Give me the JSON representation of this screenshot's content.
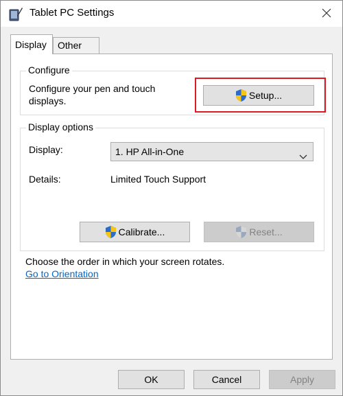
{
  "window": {
    "title": "Tablet PC Settings",
    "icons": {
      "app": "tablet-pen-icon",
      "close": "close-icon"
    }
  },
  "tabs": [
    {
      "label": "Display",
      "active": true
    },
    {
      "label": "Other",
      "active": false
    }
  ],
  "configure": {
    "legend": "Configure",
    "description_line1": "Configure your pen and touch",
    "description_line2": "displays.",
    "setup_label": "Setup..."
  },
  "display_options": {
    "legend": "Display options",
    "display_label": "Display:",
    "display_value": "1. HP All-in-One",
    "details_label": "Details:",
    "details_value": "Limited Touch Support",
    "calibrate_label": "Calibrate...",
    "reset_label": "Reset..."
  },
  "orientation": {
    "text": "Choose the order in which your screen rotates.",
    "link": "Go to Orientation"
  },
  "footer": {
    "ok_label": "OK",
    "cancel_label": "Cancel",
    "apply_label": "Apply"
  },
  "colors": {
    "highlight": "#e0191e",
    "link": "#0066cc",
    "shield_blue": "#2d6bc7",
    "shield_yellow": "#f5c518"
  }
}
